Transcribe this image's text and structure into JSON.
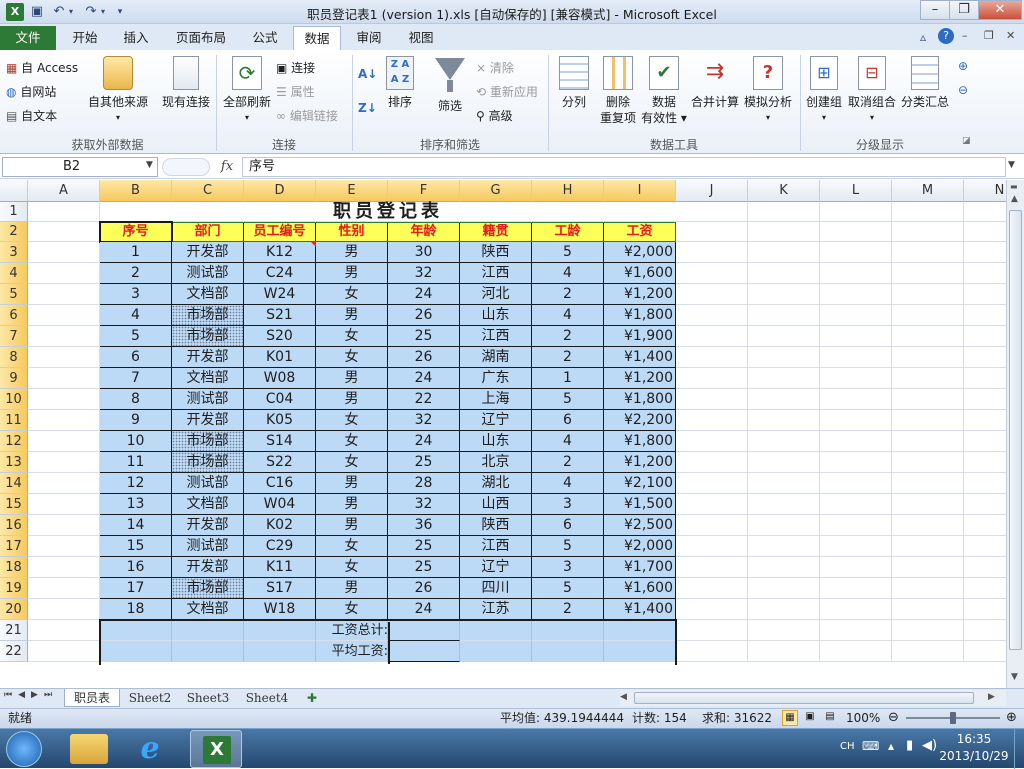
{
  "window": {
    "title": "职员登记表1 (version 1).xls [自动保存的]  [兼容模式]  -  Microsoft Excel"
  },
  "tabs": [
    "文件",
    "开始",
    "插入",
    "页面布局",
    "公式",
    "数据",
    "审阅",
    "视图"
  ],
  "ribbon": {
    "ext": {
      "access": "自 Access",
      "web": "自网站",
      "text": "自文本",
      "other": "自其他来源",
      "existing": "现有连接",
      "label": "获取外部数据"
    },
    "conn": {
      "refresh": "全部刷新",
      "connections": "连接",
      "properties": "属性",
      "editlinks": "编辑链接",
      "label": "连接"
    },
    "sort": {
      "sort": "排序",
      "filter": "筛选",
      "clear": "清除",
      "reapply": "重新应用",
      "advanced": "高级",
      "label": "排序和筛选"
    },
    "tools": {
      "split": "分列",
      "dedupe1": "删除",
      "dedupe2": "重复项",
      "valid1": "数据",
      "valid2": "有效性",
      "consolidate": "合并计算",
      "whatif": "模拟分析",
      "label": "数据工具"
    },
    "outline": {
      "group": "创建组",
      "ungroup": "取消组合",
      "subtotal": "分类汇总",
      "label": "分级显示"
    }
  },
  "namebox": "B2",
  "formula": "序号",
  "columns": [
    "A",
    "B",
    "C",
    "D",
    "E",
    "F",
    "G",
    "H",
    "I",
    "J",
    "K",
    "L",
    "M",
    "N"
  ],
  "rows": [
    "1",
    "2",
    "3",
    "4",
    "5",
    "6",
    "7",
    "8",
    "9",
    "10",
    "11",
    "12",
    "13",
    "14",
    "15",
    "16",
    "17",
    "18",
    "19",
    "20",
    "21",
    "22"
  ],
  "sheet": {
    "title": "职员登记表",
    "headers": [
      "序号",
      "部门",
      "员工编号",
      "性别",
      "年龄",
      "籍贯",
      "工龄",
      "工资"
    ],
    "data": [
      [
        "1",
        "开发部",
        "K12",
        "男",
        "30",
        "陕西",
        "5",
        "¥2,000"
      ],
      [
        "2",
        "测试部",
        "C24",
        "男",
        "32",
        "江西",
        "4",
        "¥1,600"
      ],
      [
        "3",
        "文档部",
        "W24",
        "女",
        "24",
        "河北",
        "2",
        "¥1,200"
      ],
      [
        "4",
        "市场部",
        "S21",
        "男",
        "26",
        "山东",
        "4",
        "¥1,800"
      ],
      [
        "5",
        "市场部",
        "S20",
        "女",
        "25",
        "江西",
        "2",
        "¥1,900"
      ],
      [
        "6",
        "开发部",
        "K01",
        "女",
        "26",
        "湖南",
        "2",
        "¥1,400"
      ],
      [
        "7",
        "文档部",
        "W08",
        "男",
        "24",
        "广东",
        "1",
        "¥1,200"
      ],
      [
        "8",
        "测试部",
        "C04",
        "男",
        "22",
        "上海",
        "5",
        "¥1,800"
      ],
      [
        "9",
        "开发部",
        "K05",
        "女",
        "32",
        "辽宁",
        "6",
        "¥2,200"
      ],
      [
        "10",
        "市场部",
        "S14",
        "女",
        "24",
        "山东",
        "4",
        "¥1,800"
      ],
      [
        "11",
        "市场部",
        "S22",
        "女",
        "25",
        "北京",
        "2",
        "¥1,200"
      ],
      [
        "12",
        "测试部",
        "C16",
        "男",
        "28",
        "湖北",
        "4",
        "¥2,100"
      ],
      [
        "13",
        "文档部",
        "W04",
        "男",
        "32",
        "山西",
        "3",
        "¥1,500"
      ],
      [
        "14",
        "开发部",
        "K02",
        "男",
        "36",
        "陕西",
        "6",
        "¥2,500"
      ],
      [
        "15",
        "测试部",
        "C29",
        "女",
        "25",
        "江西",
        "5",
        "¥2,000"
      ],
      [
        "16",
        "开发部",
        "K11",
        "女",
        "25",
        "辽宁",
        "3",
        "¥1,700"
      ],
      [
        "17",
        "市场部",
        "S17",
        "男",
        "26",
        "四川",
        "5",
        "¥1,600"
      ],
      [
        "18",
        "文档部",
        "W18",
        "女",
        "24",
        "江苏",
        "2",
        "¥1,400"
      ]
    ],
    "total_label": "工资总计:",
    "avg_label": "平均工资:"
  },
  "sheettabs": [
    "职员表",
    "Sheet2",
    "Sheet3",
    "Sheet4"
  ],
  "status": {
    "ready": "就绪",
    "avg": "平均值: 439.1944444",
    "count": "计数: 154",
    "sum": "求和: 31622",
    "zoom": "100%"
  },
  "taskbar": {
    "lang": "CH",
    "time": "16:35",
    "date": "2013/10/29"
  }
}
